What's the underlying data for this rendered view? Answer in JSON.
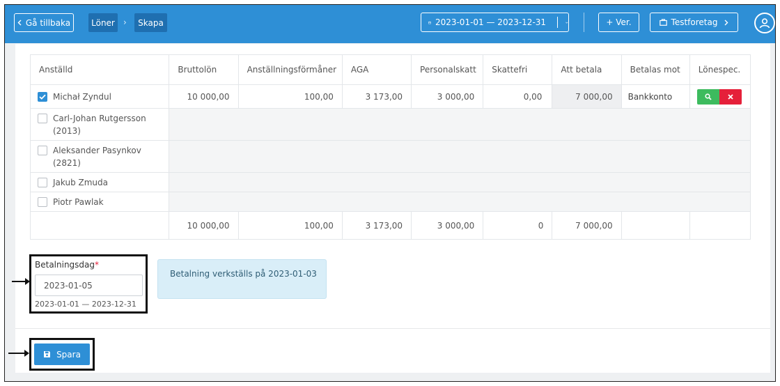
{
  "topbar": {
    "back_label": "Gå tillbaka",
    "breadcrumbs": [
      "Löner",
      "Skapa"
    ],
    "date_range": "2023-01-01 — 2023-12-31",
    "new_ver_label": "+ Ver.",
    "company_label": "Testforetag",
    "colors": {
      "bar": "#2e8fd6",
      "crumb_bg": "#1f6fb0"
    },
    "icons": [
      "chevron-left-icon",
      "chevron-right-icon",
      "calendar-icon",
      "chevron-down-icon",
      "briefcase-icon",
      "user-avatar-icon"
    ]
  },
  "table": {
    "columns": [
      "Anställd",
      "Bruttolön",
      "Anställningsförmåner",
      "AGA",
      "Personalskatt",
      "Skattefri",
      "Att betala",
      "Betalas mot",
      "Lönespec."
    ],
    "rows": [
      {
        "name": "Michał Zyndul",
        "checked": true,
        "bruttolon": "10 000,00",
        "formaner": "100,00",
        "aga": "3 173,00",
        "personalskatt": "3 000,00",
        "skattefri": "0,00",
        "att_betala": "7 000,00",
        "betalas_mot": "Bankkonto"
      },
      {
        "name": "Carl-Johan Rutgersson (2013)",
        "checked": false
      },
      {
        "name": "Aleksander Pasynkov (2821)",
        "checked": false
      },
      {
        "name": "Jakub Zmuda",
        "checked": false
      },
      {
        "name": "Piotr Pawlak",
        "checked": false
      }
    ],
    "totals": {
      "bruttolon": "10 000,00",
      "formaner": "100,00",
      "aga": "3 173,00",
      "personalskatt": "3 000,00",
      "skattefri": "0",
      "att_betala": "7 000,00"
    },
    "action_icons": [
      "search-icon",
      "close-icon"
    ],
    "colors": {
      "green": "#3dbb5e",
      "red": "#e5203a"
    }
  },
  "payment": {
    "label": "Betalningsdag",
    "required_mark": "*",
    "value": "2023-01-05",
    "range_hint": "2023-01-01 — 2023-12-31",
    "info_text": "Betalning verkställs på 2023-01-03"
  },
  "actions": {
    "save_label": "Spara",
    "save_icon": "floppy-disk-icon"
  }
}
